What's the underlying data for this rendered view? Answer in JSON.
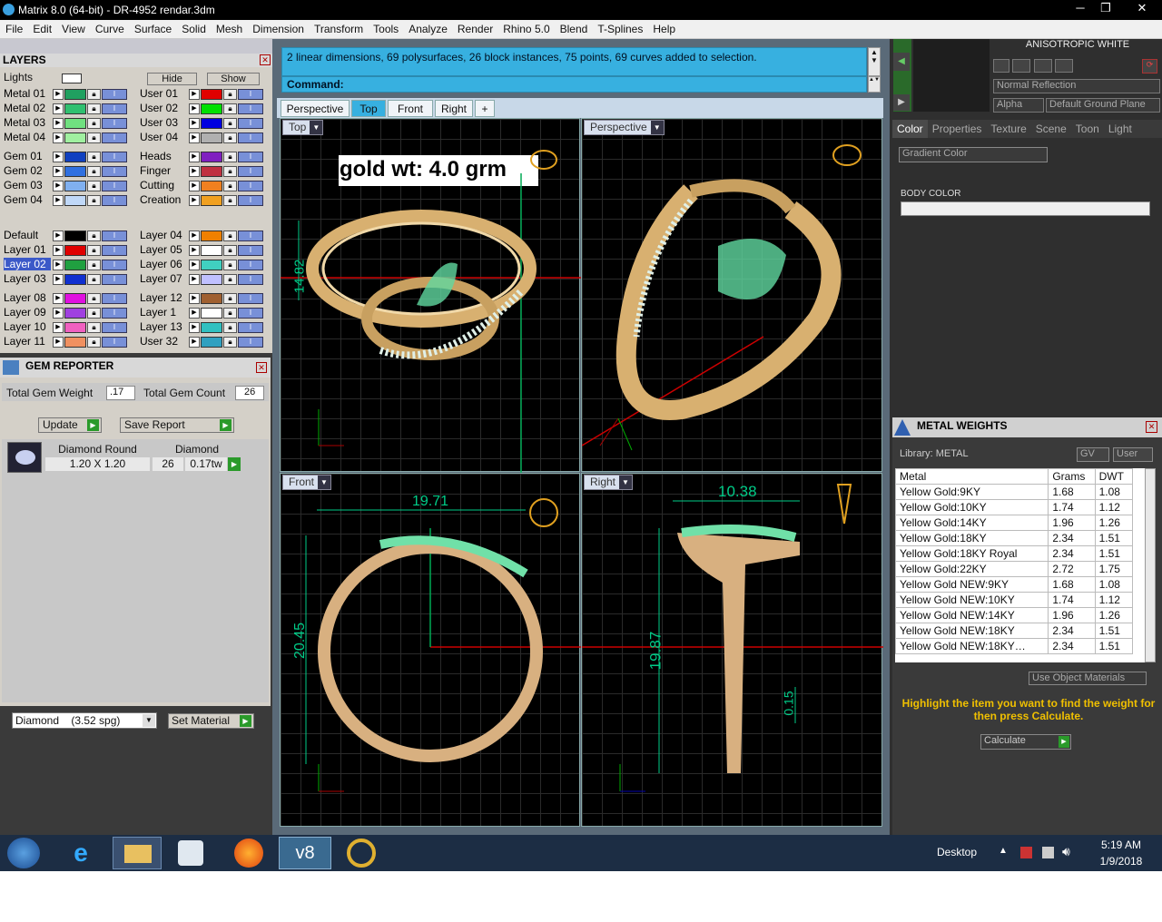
{
  "window": {
    "title": "Matrix 8.0 (64-bit) - DR-4952 rendar.3dm"
  },
  "menu": [
    "File",
    "Edit",
    "View",
    "Curve",
    "Surface",
    "Solid",
    "Mesh",
    "Dimension",
    "Transform",
    "Tools",
    "Analyze",
    "Render",
    "Rhino 5.0",
    "Blend",
    "T-Splines",
    "Help"
  ],
  "layers": {
    "title": "LAYERS",
    "lights_label": "Lights",
    "hide_label": "Hide",
    "show_label": "Show",
    "left": [
      {
        "name": "Metal 01",
        "color": "#20a060"
      },
      {
        "name": "Metal 02",
        "color": "#30c070"
      },
      {
        "name": "Metal 03",
        "color": "#70e080"
      },
      {
        "name": "Metal 04",
        "color": "#a0f0a0"
      },
      {
        "name": "Gem 01",
        "color": "#1040c0"
      },
      {
        "name": "Gem 02",
        "color": "#3070e0"
      },
      {
        "name": "Gem 03",
        "color": "#80b0f0"
      },
      {
        "name": "Gem 04",
        "color": "#c0d8f8"
      },
      {
        "name": "Default",
        "color": "#000000"
      },
      {
        "name": "Layer 01",
        "color": "#e00000"
      },
      {
        "name": "Layer 02",
        "color": "#20a040"
      },
      {
        "name": "Layer 03",
        "color": "#1030d0"
      },
      {
        "name": "Layer 08",
        "color": "#e010e0"
      },
      {
        "name": "Layer 09",
        "color": "#a040e0"
      },
      {
        "name": "Layer 10",
        "color": "#f060c0"
      },
      {
        "name": "Layer 11",
        "color": "#f09060"
      }
    ],
    "right": [
      {
        "name": "User 01",
        "color": "#e00000"
      },
      {
        "name": "User 02",
        "color": "#00e000"
      },
      {
        "name": "User 03",
        "color": "#0000e0"
      },
      {
        "name": "User 04",
        "color": "#b0b0b0"
      },
      {
        "name": "Heads",
        "color": "#8020c0"
      },
      {
        "name": "Finger",
        "color": "#c03040"
      },
      {
        "name": "Cutting",
        "color": "#f08020"
      },
      {
        "name": "Creation",
        "color": "#f0a020"
      },
      {
        "name": "Layer 04",
        "color": "#f08000"
      },
      {
        "name": "Layer 05",
        "color": "#ffffff"
      },
      {
        "name": "Layer 06",
        "color": "#40d0c0"
      },
      {
        "name": "Layer 07",
        "color": "#c0c0ff"
      },
      {
        "name": "Layer 12",
        "color": "#a06030"
      },
      {
        "name": "Layer 1",
        "color": "#ffffff"
      },
      {
        "name": "Layer 13",
        "color": "#30c0c0"
      },
      {
        "name": "User 32",
        "color": "#30a0c0"
      }
    ]
  },
  "gem": {
    "title": "GEM REPORTER",
    "tw_label": "Total Gem Weight",
    "tw_value": ".17",
    "tc_label": "Total Gem Count",
    "tc_value": "26",
    "update": "Update",
    "save": "Save Report",
    "h1": "Diamond Round",
    "h2": "Diamond",
    "size": "1.20 X 1.20",
    "count": "26",
    "weight": "0.17tw",
    "material": "Diamond    (3.52 spg)",
    "set_material": "Set Material"
  },
  "command": {
    "message": "2 linear dimensions, 69 polysurfaces, 26 block instances, 75 points, 69 curves added to selection.",
    "prompt": "Command:"
  },
  "viewtabs": [
    "Perspective",
    "Top",
    "Front",
    "Right",
    "+"
  ],
  "viewports": {
    "top": {
      "label": "Top",
      "note": "gold wt: 4.0 grm",
      "dim": "14.82"
    },
    "persp": {
      "label": "Perspective"
    },
    "front": {
      "label": "Front",
      "dim_w": "19.71",
      "dim_h": "20.45"
    },
    "right": {
      "label": "Right",
      "dim_w": "10.38",
      "dim_h": "19.87",
      "dim_s": "0.15"
    }
  },
  "material_panel": {
    "title": "ANISOTROPIC WHITE",
    "reflection": "Normal Reflection",
    "alpha": "Alpha",
    "ground": "Default Ground Plane",
    "tabs": [
      "Color",
      "Properties",
      "Texture",
      "Scene",
      "Toon",
      "Light"
    ],
    "gradient": "Gradient Color",
    "body_color": "BODY COLOR"
  },
  "metal": {
    "title": "METAL WEIGHTS",
    "library": "Library: METAL",
    "gv": "GV",
    "user": "User",
    "headers": [
      "Metal",
      "Grams",
      "DWT"
    ],
    "rows": [
      [
        "Yellow Gold:9KY",
        "1.68",
        "1.08"
      ],
      [
        "Yellow Gold:10KY",
        "1.74",
        "1.12"
      ],
      [
        "Yellow Gold:14KY",
        "1.96",
        "1.26"
      ],
      [
        "Yellow Gold:18KY",
        "2.34",
        "1.51"
      ],
      [
        "Yellow Gold:18KY Royal",
        "2.34",
        "1.51"
      ],
      [
        "Yellow Gold:22KY",
        "2.72",
        "1.75"
      ],
      [
        "Yellow Gold NEW:9KY",
        "1.68",
        "1.08"
      ],
      [
        "Yellow Gold NEW:10KY",
        "1.74",
        "1.12"
      ],
      [
        "Yellow Gold NEW:14KY",
        "1.96",
        "1.26"
      ],
      [
        "Yellow Gold NEW:18KY",
        "2.34",
        "1.51"
      ],
      [
        "Yellow Gold NEW:18KY…",
        "2.34",
        "1.51"
      ]
    ],
    "use_obj": "Use Object Materials",
    "hint": "Highlight the item you want to find the weight for then press Calculate.",
    "calc": "Calculate"
  },
  "taskbar": {
    "desktop": "Desktop",
    "time": "5:19 AM",
    "date": "1/9/2018"
  }
}
